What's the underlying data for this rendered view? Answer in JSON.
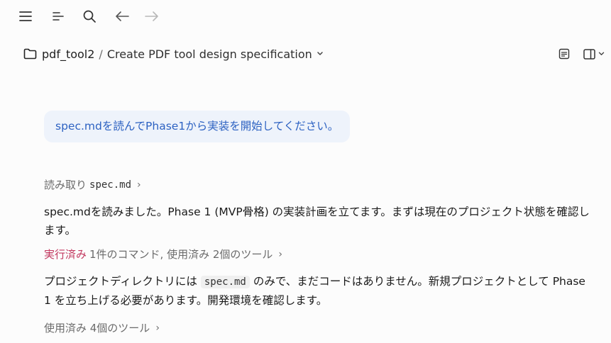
{
  "toolbar": {
    "icons": [
      "menu-icon",
      "sort-icon",
      "search-icon",
      "back-arrow-icon",
      "forward-arrow-icon"
    ]
  },
  "header": {
    "project": "pdf_tool2",
    "separator": "/",
    "title": "Create PDF tool design specification",
    "icons": [
      "folder-icon",
      "chevron-down-icon",
      "document-icon",
      "panel-toggle-icon",
      "chevron-down-icon"
    ]
  },
  "chat": {
    "user_message": "spec.mdを読んでPhase1から実装を開始してください。",
    "read_step": {
      "label": "読み取り",
      "file": "spec.md"
    },
    "assistant_message_1": "spec.mdを読みました。Phase 1 (MVP骨格) の実装計画を立てます。まずは現在のプロジェクト状態を確認します。",
    "exec_step": {
      "label": "実行済み",
      "detail": "1件のコマンド, 使用済み 2個のツール"
    },
    "assistant_message_2": {
      "prefix": "プロジェクトディレクトリには",
      "code": "spec.md",
      "suffix": "のみで、まだコードはありません。新規プロジェクトとして Phase 1 を立ち上げる必要があります。開発環境を確認します。"
    },
    "tools_step": {
      "label": "使用済み 4個のツール"
    }
  },
  "colors": {
    "user_bubble_bg": "#eef3fb",
    "user_bubble_text": "#2d62c2",
    "exec_accent": "#c2385f"
  }
}
